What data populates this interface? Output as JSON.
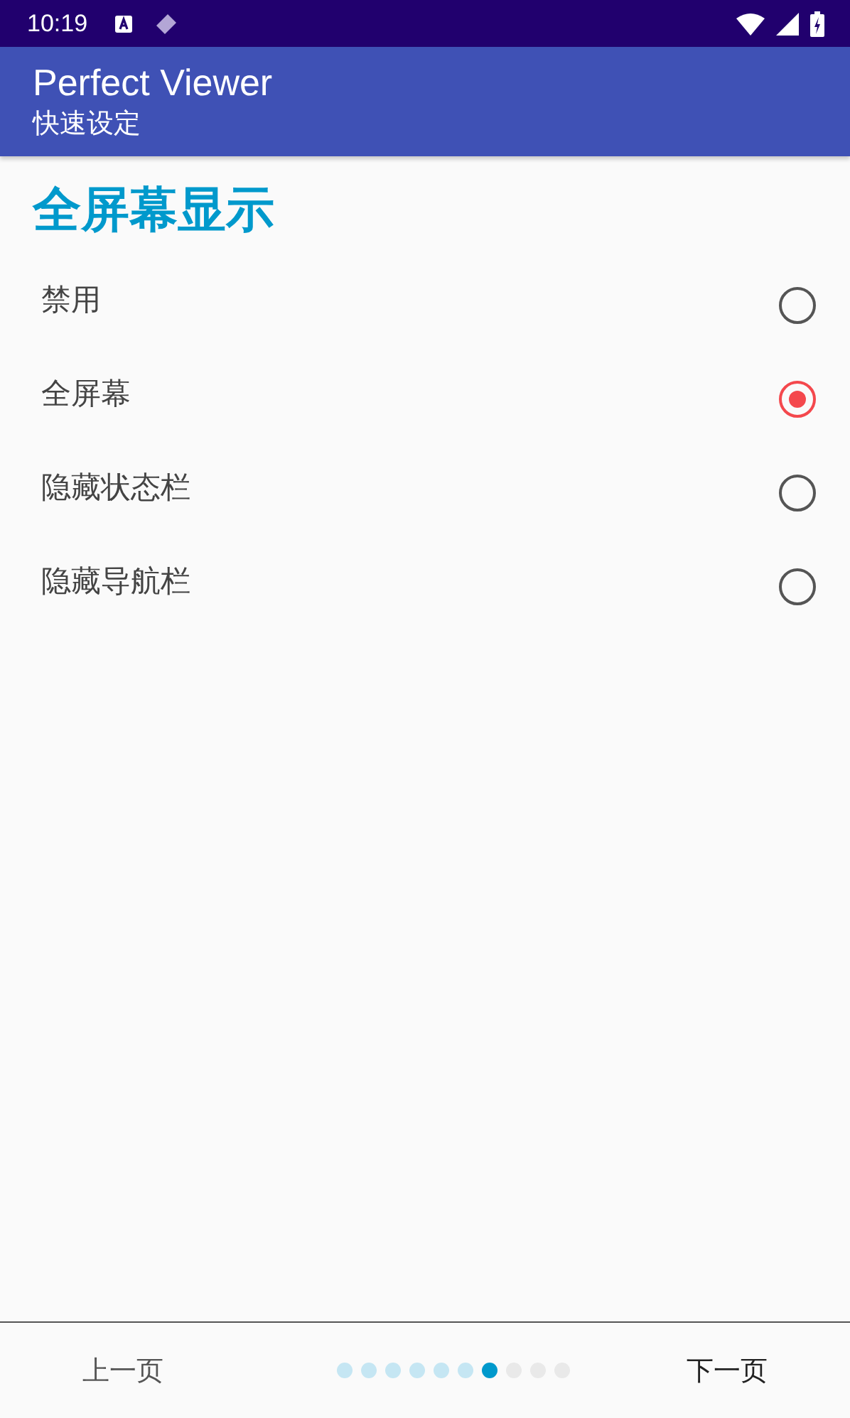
{
  "status_bar": {
    "time": "10:19"
  },
  "app_bar": {
    "title": "Perfect Viewer",
    "subtitle": "快速设定"
  },
  "section": {
    "title": "全屏幕显示"
  },
  "options": [
    {
      "label": "禁用",
      "selected": false
    },
    {
      "label": "全屏幕",
      "selected": true
    },
    {
      "label": "隐藏状态栏",
      "selected": false
    },
    {
      "label": "隐藏导航栏",
      "selected": false
    }
  ],
  "footer": {
    "prev": "上一页",
    "next": "下一页",
    "dots": [
      {
        "kind": "done"
      },
      {
        "kind": "done"
      },
      {
        "kind": "done"
      },
      {
        "kind": "done"
      },
      {
        "kind": "done"
      },
      {
        "kind": "done"
      },
      {
        "kind": "current"
      },
      {
        "kind": "upcoming"
      },
      {
        "kind": "upcoming"
      },
      {
        "kind": "upcoming"
      }
    ]
  }
}
